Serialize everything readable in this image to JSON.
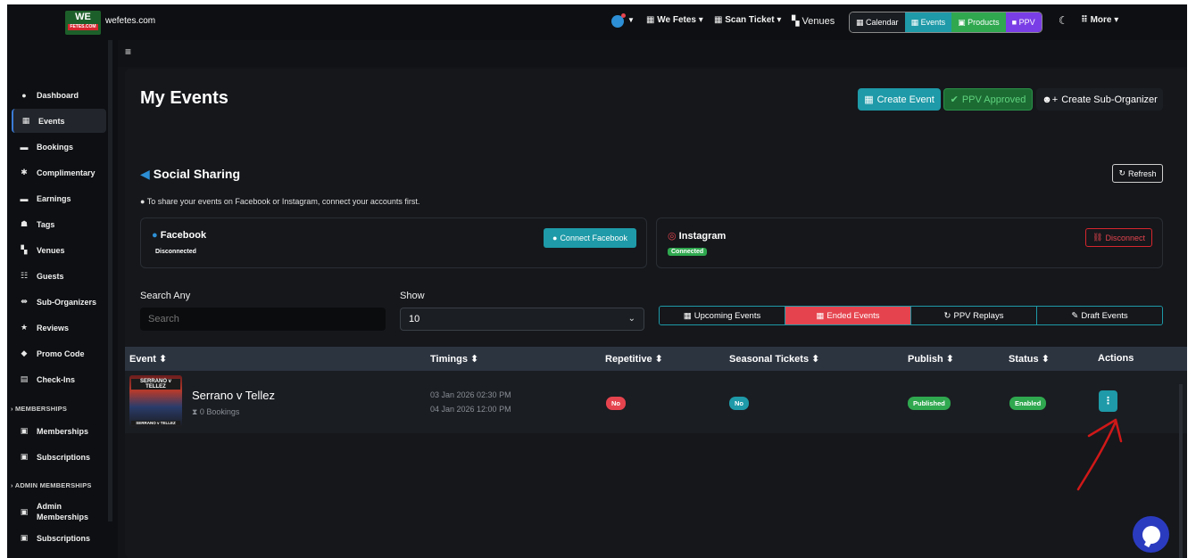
{
  "topnav": {
    "logo_text": "WE",
    "logo_sub": "FETES.COM",
    "site_name": "wefetes.com",
    "items": [
      {
        "label": "We Fetes",
        "icon": "building-icon"
      },
      {
        "label": "Scan Ticket",
        "icon": "grid-icon"
      },
      {
        "label": "Venues",
        "icon": "map-icon"
      }
    ],
    "modes": [
      {
        "label": "Calendar",
        "icon": "calendar-icon"
      },
      {
        "label": "Events",
        "icon": "calendar-check-icon"
      },
      {
        "label": "Products",
        "icon": "bag-icon"
      },
      {
        "label": "PPV",
        "icon": "video-icon"
      }
    ],
    "more_label": "More"
  },
  "sidebar": {
    "items": [
      {
        "label": "Dashboard"
      },
      {
        "label": "Events"
      },
      {
        "label": "Bookings"
      },
      {
        "label": "Complimentary"
      },
      {
        "label": "Earnings"
      },
      {
        "label": "Tags"
      },
      {
        "label": "Venues"
      },
      {
        "label": "Guests"
      },
      {
        "label": "Sub-Organizers"
      },
      {
        "label": "Reviews"
      },
      {
        "label": "Promo Code"
      },
      {
        "label": "Check-Ins"
      },
      {
        "label": "Memberships"
      },
      {
        "label": "Subscriptions"
      },
      {
        "label": "Admin Memberships"
      },
      {
        "label": "Subscriptions"
      }
    ],
    "sections": [
      "MEMBERSHIPS",
      "ADMIN MEMBERSHIPS"
    ]
  },
  "page": {
    "title": "My Events",
    "create_event": "Create Event",
    "ppv_approved": "PPV Approved",
    "create_sub_organizer": "Create Sub-Organizer"
  },
  "social": {
    "title": "Social Sharing",
    "note": "To share your events on Facebook or Instagram, connect your accounts first.",
    "refresh": "Refresh",
    "facebook": {
      "name": "Facebook",
      "status": "Disconnected",
      "action": "Connect Facebook"
    },
    "instagram": {
      "name": "Instagram",
      "status": "Connected",
      "action": "Disconnect"
    }
  },
  "filters": {
    "search_label": "Search Any",
    "search_placeholder": "Search",
    "show_label": "Show",
    "show_value": "10",
    "tabs": [
      "Upcoming Events",
      "Ended Events",
      "PPV Replays",
      "Draft Events"
    ],
    "active_tab": "Ended Events"
  },
  "table": {
    "headers": [
      "Event",
      "Timings",
      "Repetitive",
      "Seasonal Tickets",
      "Publish",
      "Status",
      "Actions"
    ],
    "rows": [
      {
        "thumb_top": "SERRANO v TELLEZ",
        "thumb_bottom": "SERRANO v TELLEZ",
        "name": "Serrano v Tellez",
        "bookings": "0 Bookings",
        "start": "03 Jan 2026 02:30 PM",
        "end": "04 Jan 2026 12:00 PM",
        "repetitive": "No",
        "seasonal": "No",
        "publish": "Published",
        "status": "Enabled",
        "action_icon": "⋮"
      }
    ]
  },
  "colors": {
    "accent": "#1e9aa8",
    "danger": "#e5444e",
    "success": "#2fa84f",
    "ppv": "#7a3ee6"
  }
}
